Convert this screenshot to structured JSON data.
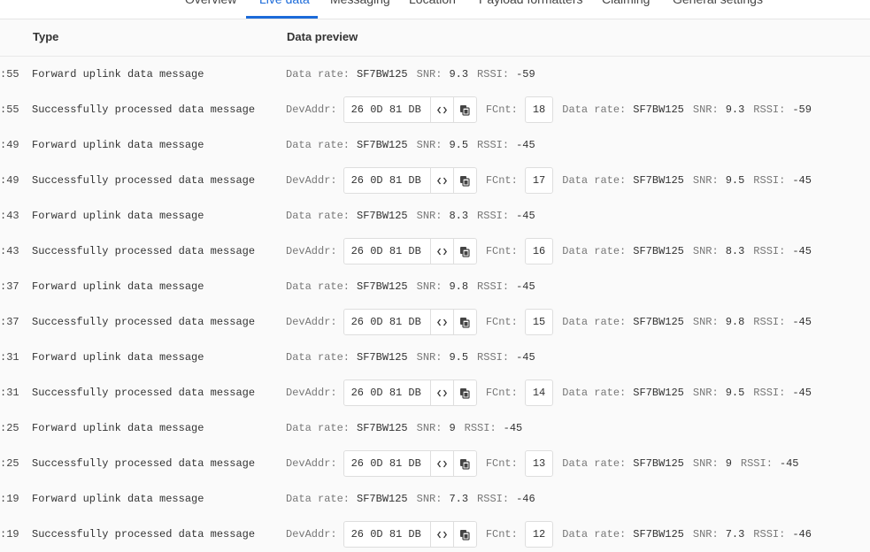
{
  "tabs": [
    {
      "label": "Overview",
      "active": false
    },
    {
      "label": "Live data",
      "active": true
    },
    {
      "label": "Messaging",
      "active": false
    },
    {
      "label": "Location",
      "active": false
    },
    {
      "label": "Payload formatters",
      "active": false
    },
    {
      "label": "Claiming",
      "active": false
    },
    {
      "label": "General settings",
      "active": false
    }
  ],
  "columns": {
    "type": "Type",
    "preview": "Data preview"
  },
  "labels": {
    "devaddr": "DevAddr:",
    "fcnt": "FCnt:",
    "data_rate": "Data rate:",
    "snr": "SNR:",
    "rssi": "RSSI:"
  },
  "icons": {
    "code": "code-icon",
    "copy": "copy-icon"
  },
  "accent_color": "#1c6bd9",
  "rows": [
    {
      "time": ":55",
      "type": "Forward uplink data message",
      "data_rate": "SF7BW125",
      "snr": "9.3",
      "rssi": "-59"
    },
    {
      "time": ":55",
      "type": "Successfully processed data message",
      "devaddr": "26 0D 81 DB",
      "fcnt": "18",
      "data_rate": "SF7BW125",
      "snr": "9.3",
      "rssi": "-59"
    },
    {
      "time": ":49",
      "type": "Forward uplink data message",
      "data_rate": "SF7BW125",
      "snr": "9.5",
      "rssi": "-45"
    },
    {
      "time": ":49",
      "type": "Successfully processed data message",
      "devaddr": "26 0D 81 DB",
      "fcnt": "17",
      "data_rate": "SF7BW125",
      "snr": "9.5",
      "rssi": "-45"
    },
    {
      "time": ":43",
      "type": "Forward uplink data message",
      "data_rate": "SF7BW125",
      "snr": "8.3",
      "rssi": "-45"
    },
    {
      "time": ":43",
      "type": "Successfully processed data message",
      "devaddr": "26 0D 81 DB",
      "fcnt": "16",
      "data_rate": "SF7BW125",
      "snr": "8.3",
      "rssi": "-45"
    },
    {
      "time": ":37",
      "type": "Forward uplink data message",
      "data_rate": "SF7BW125",
      "snr": "9.8",
      "rssi": "-45"
    },
    {
      "time": ":37",
      "type": "Successfully processed data message",
      "devaddr": "26 0D 81 DB",
      "fcnt": "15",
      "data_rate": "SF7BW125",
      "snr": "9.8",
      "rssi": "-45"
    },
    {
      "time": ":31",
      "type": "Forward uplink data message",
      "data_rate": "SF7BW125",
      "snr": "9.5",
      "rssi": "-45"
    },
    {
      "time": ":31",
      "type": "Successfully processed data message",
      "devaddr": "26 0D 81 DB",
      "fcnt": "14",
      "data_rate": "SF7BW125",
      "snr": "9.5",
      "rssi": "-45"
    },
    {
      "time": ":25",
      "type": "Forward uplink data message",
      "data_rate": "SF7BW125",
      "snr": "9",
      "rssi": "-45"
    },
    {
      "time": ":25",
      "type": "Successfully processed data message",
      "devaddr": "26 0D 81 DB",
      "fcnt": "13",
      "data_rate": "SF7BW125",
      "snr": "9",
      "rssi": "-45"
    },
    {
      "time": ":19",
      "type": "Forward uplink data message",
      "data_rate": "SF7BW125",
      "snr": "7.3",
      "rssi": "-46"
    },
    {
      "time": ":19",
      "type": "Successfully processed data message",
      "devaddr": "26 0D 81 DB",
      "fcnt": "12",
      "data_rate": "SF7BW125",
      "snr": "7.3",
      "rssi": "-46"
    }
  ]
}
